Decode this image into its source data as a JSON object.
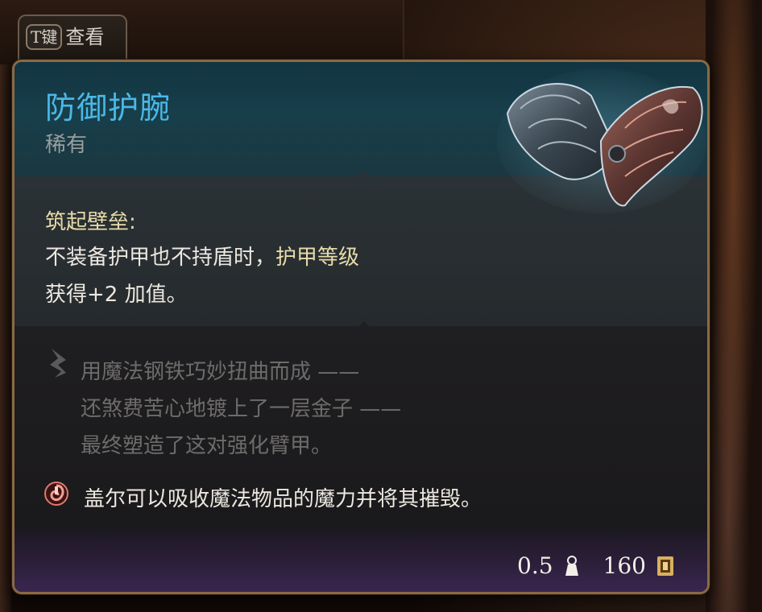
{
  "view_hint": {
    "key": "T键",
    "label": "查看"
  },
  "item": {
    "name": "防御护腕",
    "rarity": "稀有",
    "name_color": "#4ab8e6",
    "image_icon": "bracers-icon"
  },
  "effect": {
    "title": "筑起壁垒:",
    "line1_prefix": "不装备护甲也不持盾时，",
    "line1_highlight": "护甲等级",
    "line2": "获得+2 加值。"
  },
  "lore": {
    "icon": "quill-icon",
    "lines": [
      "用魔法钢铁巧妙扭曲而成 ——",
      "还煞费苦心地镀上了一层金子 ——",
      "最终塑造了这对强化臂甲。"
    ]
  },
  "warning": {
    "icon": "absorb-magic-icon",
    "text": "盖尔可以吸收魔法物品的魔力并将其摧毁。"
  },
  "footer": {
    "weight": "0.5",
    "weight_icon": "weight-icon",
    "value": "160",
    "value_icon": "gold-coin-icon"
  }
}
